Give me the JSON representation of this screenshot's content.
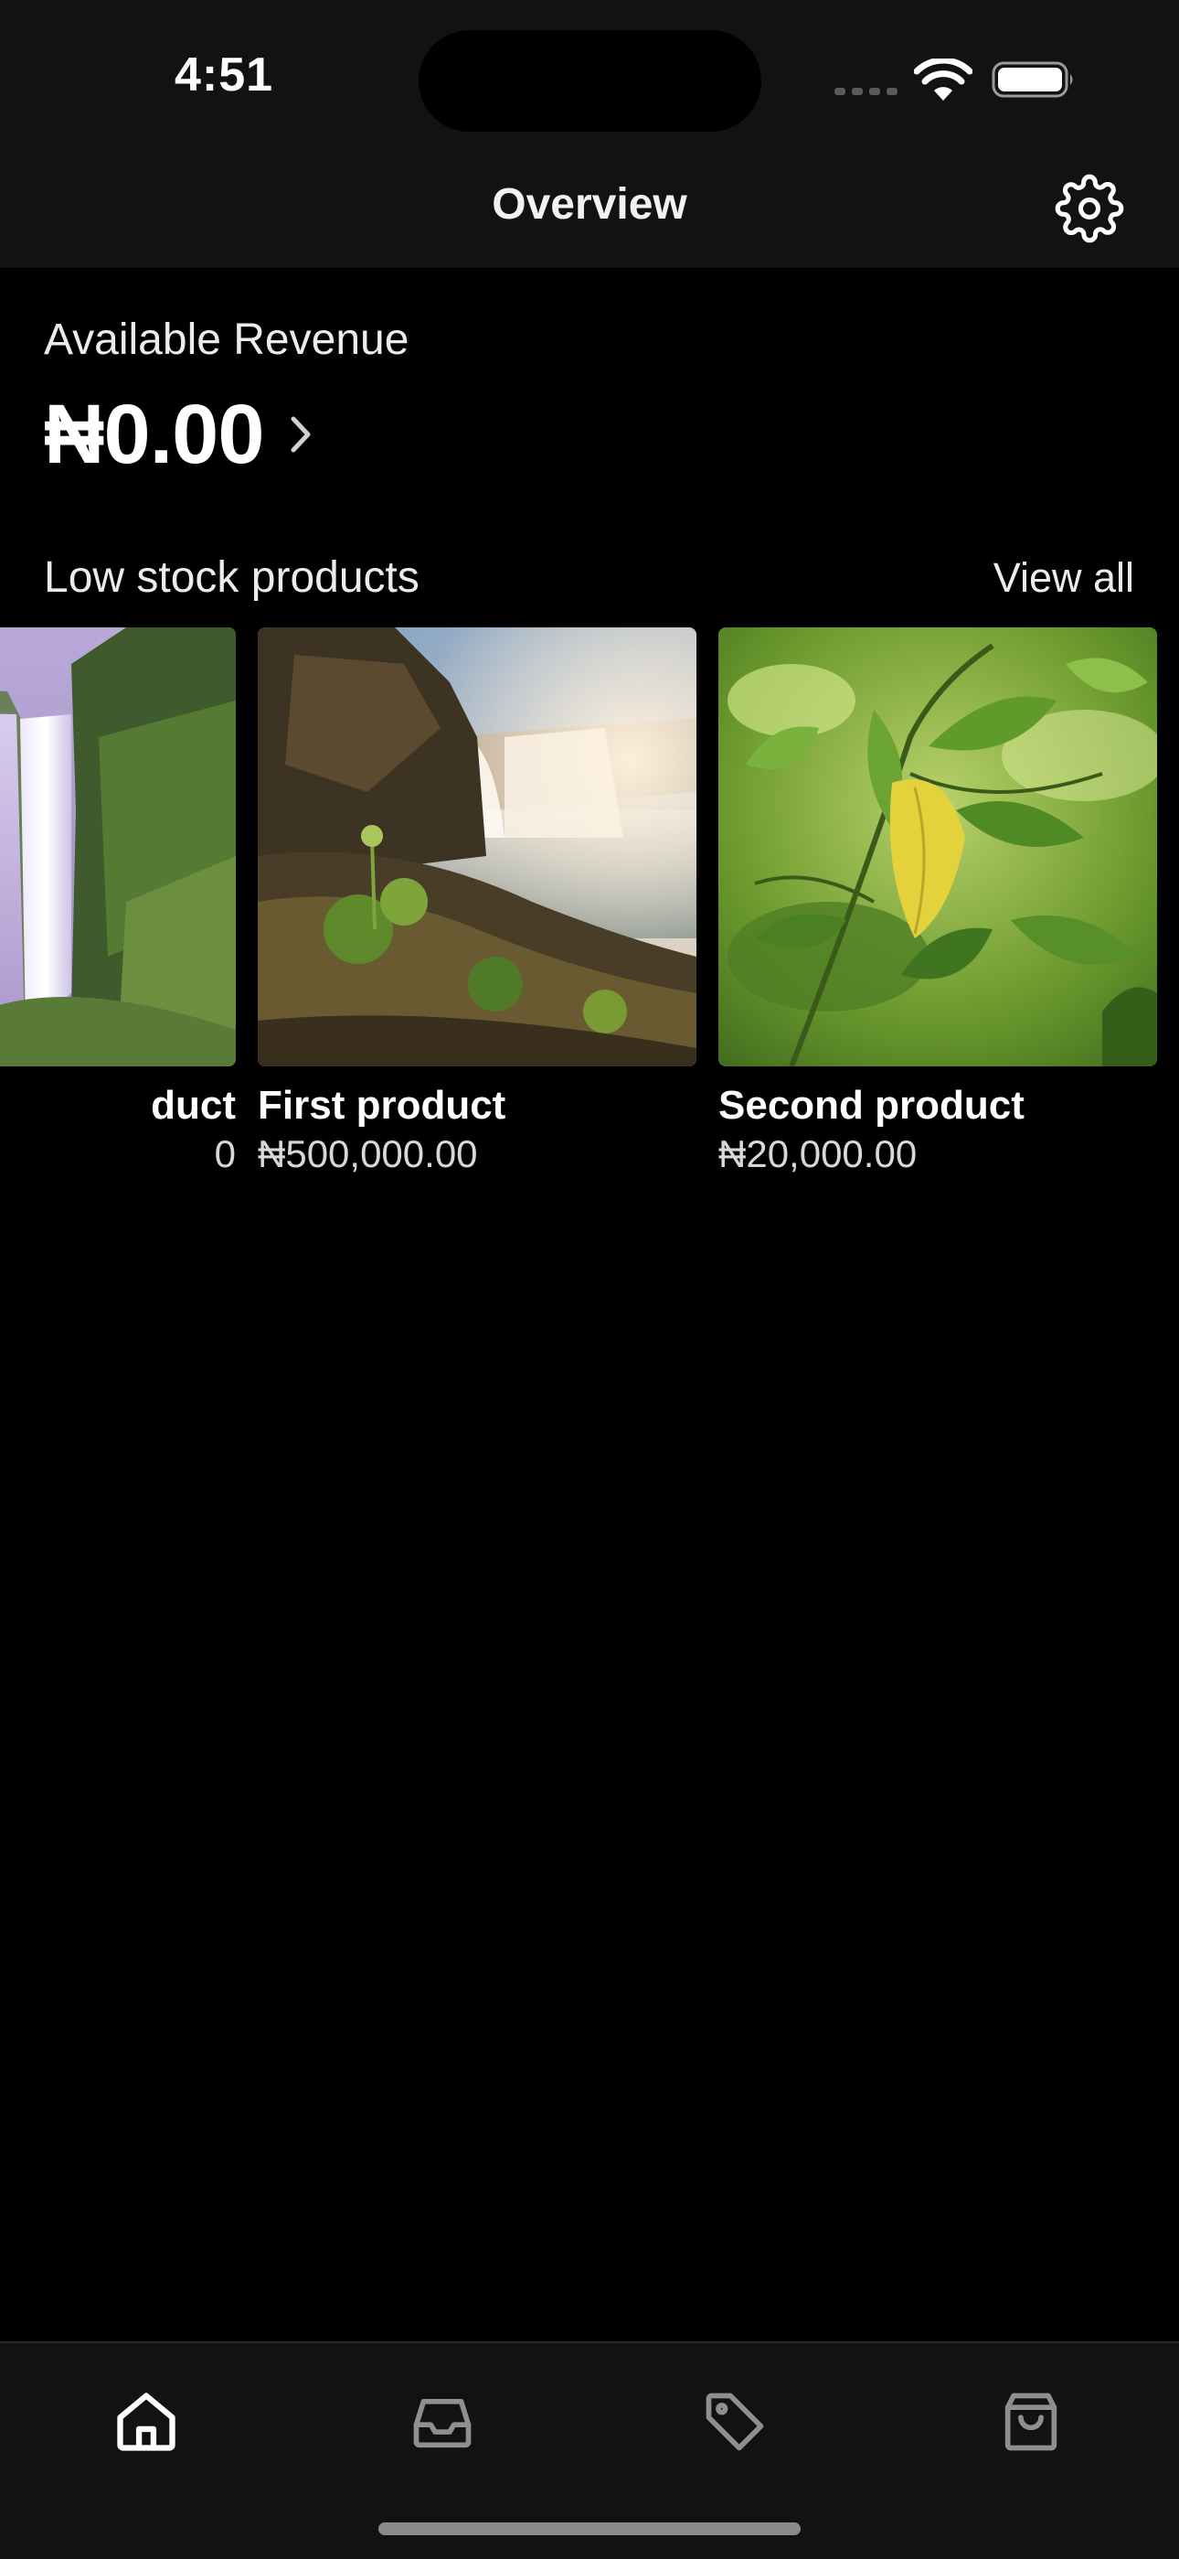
{
  "status_bar": {
    "time": "4:51"
  },
  "header": {
    "title": "Overview",
    "settings_icon": "gear-icon"
  },
  "revenue": {
    "label": "Available Revenue",
    "value": "₦0.00",
    "chevron_icon": "chevron-right-icon"
  },
  "low_stock": {
    "title": "Low stock products",
    "view_all": "View all",
    "products": [
      {
        "name": "duct",
        "price": "0",
        "image": "waterfall-cliff-image"
      },
      {
        "name": "First product",
        "price": "₦500,000.00",
        "image": "waterfall-rocks-image"
      },
      {
        "name": "Second product",
        "price": "₦20,000.00",
        "image": "green-leaves-image"
      }
    ]
  },
  "tabbar": {
    "items": [
      {
        "icon": "home-icon",
        "active": true
      },
      {
        "icon": "inbox-icon",
        "active": false
      },
      {
        "icon": "tag-icon",
        "active": false
      },
      {
        "icon": "shopping-bag-icon",
        "active": false
      }
    ]
  },
  "colors": {
    "background": "#000000",
    "bar_background": "#121212",
    "text_primary": "#ffffff",
    "text_secondary": "#d8d8d8",
    "icon_inactive": "#8e8e93"
  }
}
